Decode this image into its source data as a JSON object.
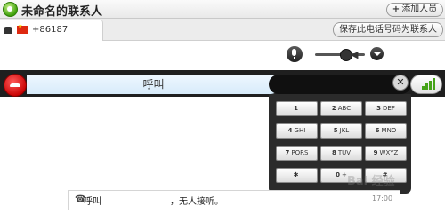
{
  "window": {
    "title": "未命名的联系人",
    "add_button": "添加人员",
    "add_icon": "+"
  },
  "tab": {
    "phone_icon": "phone-icon",
    "flag": "china-flag",
    "number": "+86187"
  },
  "header": {
    "save_button": "保存此电话号码为联系人"
  },
  "call": {
    "status": "呼叫",
    "clear_glyph": "✕",
    "colors": {
      "hangup": "#d10000",
      "signal": "#45a318",
      "bar": "#1f1f1f"
    }
  },
  "dialpad": {
    "keys": [
      {
        "digit": "1",
        "letters": ""
      },
      {
        "digit": "2",
        "letters": "ABC"
      },
      {
        "digit": "3",
        "letters": "DEF"
      },
      {
        "digit": "4",
        "letters": "GHI"
      },
      {
        "digit": "5",
        "letters": "JKL"
      },
      {
        "digit": "6",
        "letters": "MNO"
      },
      {
        "digit": "7",
        "letters": "PQRS"
      },
      {
        "digit": "8",
        "letters": "TUV"
      },
      {
        "digit": "9",
        "letters": "WXYZ"
      },
      {
        "digit": "✱",
        "letters": ""
      },
      {
        "digit": "0",
        "letters": "+"
      },
      {
        "digit": "#",
        "letters": ""
      }
    ]
  },
  "message": {
    "label": "呼叫",
    "text": "，无人接听。",
    "time": "17:00"
  },
  "watermark": "Bai 经验"
}
